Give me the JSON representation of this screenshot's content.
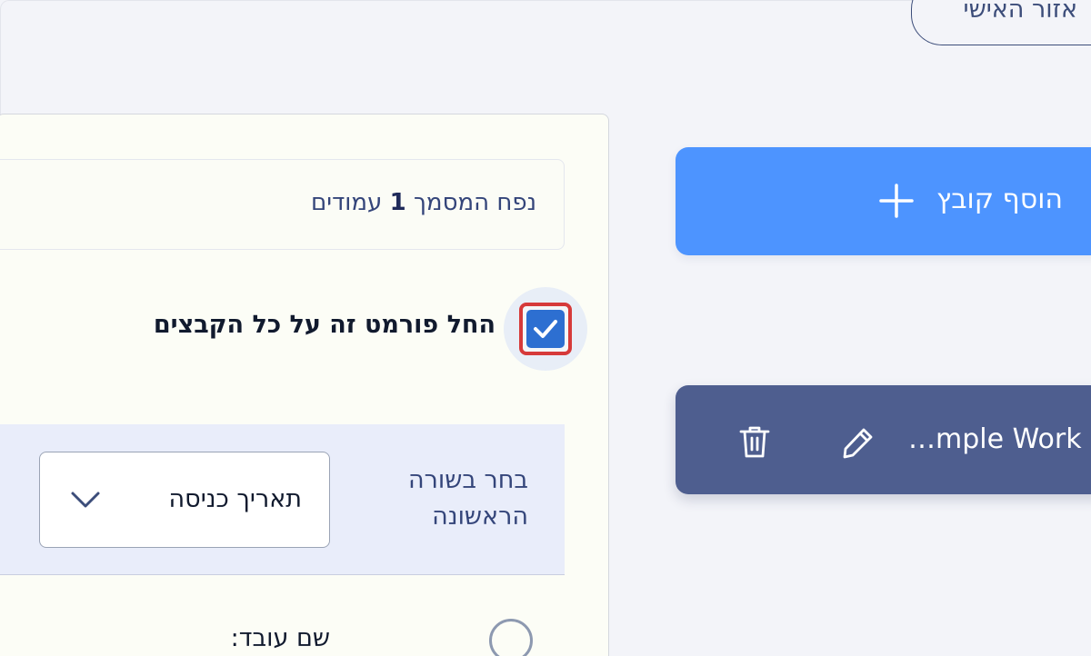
{
  "header": {
    "profile_button_label": "אזור האישי"
  },
  "format_panel": {
    "info": {
      "prefix": "נפח המסמך",
      "page_count": "1",
      "suffix": "עמודים"
    },
    "apply_all": {
      "label": "החל פורמט זה על כל הקבצים",
      "checked": true
    },
    "first_row": {
      "label": "בחר בשורה הראשונה",
      "selected_value": "תאריך כניסה"
    },
    "fields": [
      {
        "label": "שם עובד:",
        "selected": false
      }
    ]
  },
  "files": {
    "add_button_label": "הוסף קובץ",
    "items": [
      {
        "name": "…mple Work"
      }
    ]
  },
  "colors": {
    "primary": "#4d94ff",
    "card": "#4e5e8f",
    "checkbox": "#2d6fd1",
    "highlight": "#d63a3a"
  }
}
